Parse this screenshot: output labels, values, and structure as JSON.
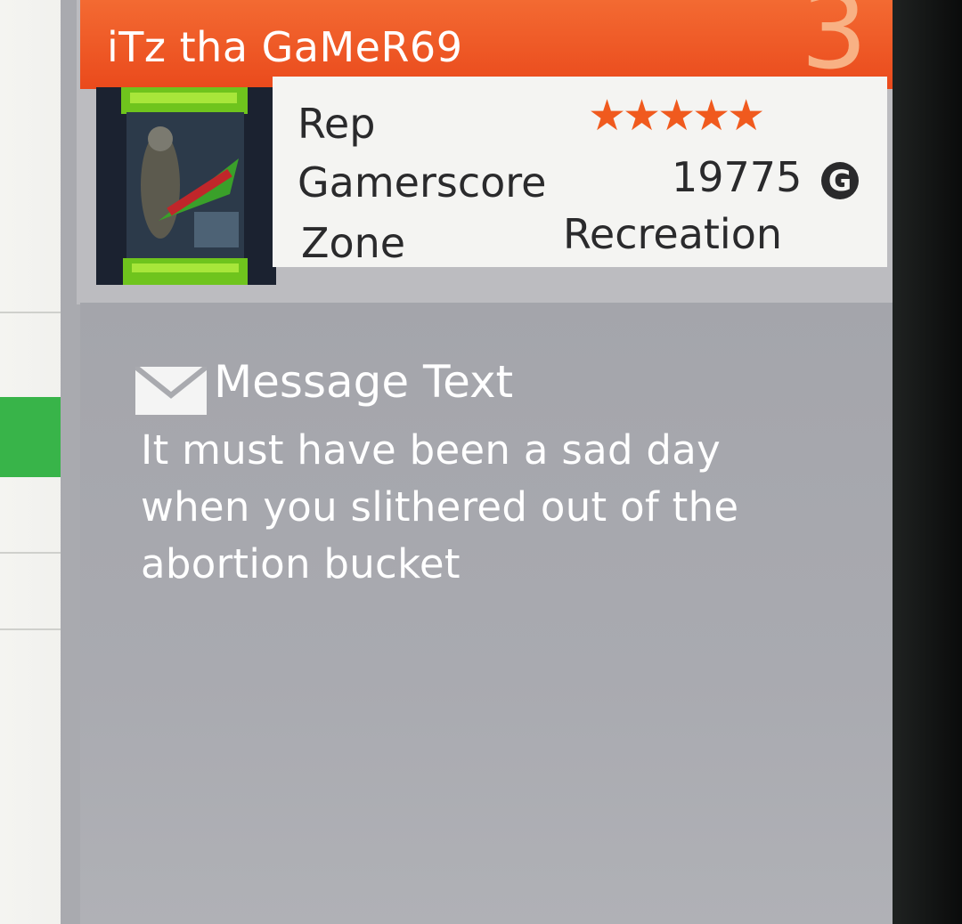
{
  "profile": {
    "gamertag": "iTz tha GaMeR69",
    "rank_number": "3",
    "rep_label": "Rep",
    "rep_stars": "★★★★★",
    "rep_rating": 5,
    "gamerscore_label": "Gamerscore",
    "gamerscore_value": "19775",
    "gamerscore_icon": "G",
    "zone_label": "Zone",
    "zone_value": "Recreation"
  },
  "message": {
    "title": "Message Text",
    "lines": [
      "It must have been a sad day",
      "when you slithered out of the",
      "abortion bucket"
    ]
  },
  "colors": {
    "header_orange": "#ea4a1c",
    "star_orange": "#f05a1e",
    "panel_grey": "#a9aaaf",
    "selected_green": "#38b449"
  },
  "icons": {
    "envelope": "envelope-icon",
    "gamerscore": "gamerscore-icon",
    "star": "star-icon"
  }
}
